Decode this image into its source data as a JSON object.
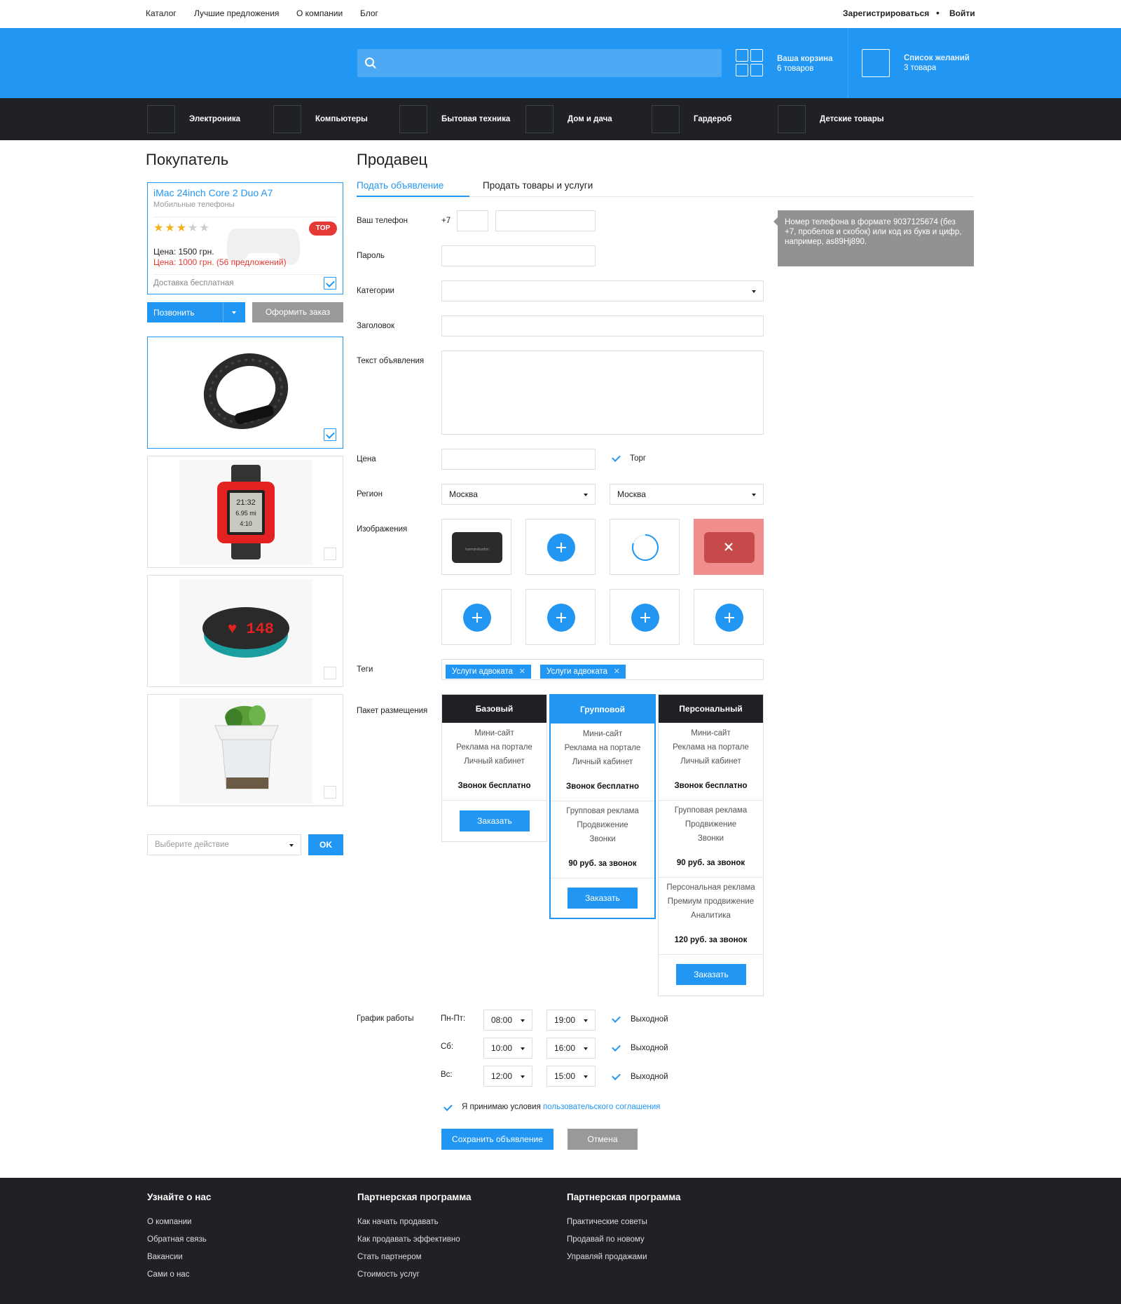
{
  "topnav": {
    "links": [
      "Каталог",
      "Лучшие предложения",
      "О компании",
      "Блог"
    ],
    "register": "Зарегистрироваться",
    "login": "Войти"
  },
  "header": {
    "search_placeholder": "",
    "cart": {
      "title": "Ваша корзина",
      "count": "6 товаров"
    },
    "wishlist": {
      "title": "Список желаний",
      "count": "3 товара"
    }
  },
  "categories": [
    "Электроника",
    "Компьютеры",
    "Бытовая техника",
    "Дом и дача",
    "Гардероб",
    "Детские товары"
  ],
  "buyer": {
    "title": "Покупатель",
    "product": {
      "name": "iMac 24inch Core 2 Duo A7",
      "category": "Мобильные телефоны",
      "rating": 3,
      "badge": "TOP",
      "price_old": "Цена: 1500 грн.",
      "price_new": "Цена: 1000 грн. (56 предложений)",
      "delivery": "Доставка бесплатная"
    },
    "call_button": "Позвонить",
    "order_button": "Оформить заказ",
    "action_placeholder": "Выберите действие",
    "ok_button": "OK"
  },
  "seller": {
    "title": "Продавец",
    "tabs": [
      "Подать объявление",
      "Продать товары и услуги"
    ],
    "labels": {
      "phone": "Ваш телефон",
      "phone_prefix": "+7",
      "password": "Пароль",
      "category": "Категории",
      "headline": "Заголовок",
      "text": "Текст объявления",
      "price": "Цена",
      "bargain": "Торг",
      "region": "Регион",
      "images": "Изображения",
      "tags": "Теги",
      "package": "Пакет размещения",
      "schedule": "График работы"
    },
    "regions": [
      "Москва",
      "Москва"
    ],
    "tooltip": "Номер телефона в формате 9037125674 (без +7, пробелов и скобок) или код из букв и цифр, например, as89Hj890.",
    "tags": [
      "Услуги адвоката",
      "Услуги адвоката"
    ],
    "packages": [
      {
        "name": "Базовый",
        "features": [
          "Мини-сайт",
          "Реклама на портале",
          "Личный кабинет"
        ],
        "price": "Звонок бесплатно",
        "order": "Заказать"
      },
      {
        "name": "Групповой",
        "features": [
          "Мини-сайт",
          "Реклама на портале",
          "Личный кабинет"
        ],
        "price": "Звонок бесплатно",
        "features2": [
          "Групповая реклама",
          "Продвижение",
          "Звонки"
        ],
        "price2": "90 руб. за звонок",
        "order": "Заказать"
      },
      {
        "name": "Персональный",
        "features": [
          "Мини-сайт",
          "Реклама на портале",
          "Личный кабинет"
        ],
        "price": "Звонок бесплатно",
        "features2": [
          "Групповая реклама",
          "Продвижение",
          "Звонки"
        ],
        "price2": "90 руб. за звонок",
        "features3": [
          "Персональная реклама",
          "Премиум продвижение",
          "Аналитика"
        ],
        "price3": "120 руб. за звонок",
        "order": "Заказать"
      }
    ],
    "schedule": [
      {
        "day": "Пн-Пт:",
        "from": "08:00",
        "to": "19:00",
        "dayoff": "Выходной"
      },
      {
        "day": "Сб:",
        "from": "10:00",
        "to": "16:00",
        "dayoff": "Выходной"
      },
      {
        "day": "Вс:",
        "from": "12:00",
        "to": "15:00",
        "dayoff": "Выходной"
      }
    ],
    "agree_text": "Я принимаю условия",
    "agree_link": "пользовательского соглашения",
    "save_button": "Сохранить объявление",
    "cancel_button": "Отмена"
  },
  "footer": {
    "columns": [
      {
        "title": "Узнайте о нас",
        "links": [
          "О компании",
          "Обратная связь",
          "Вакансии",
          "Сами о нас"
        ]
      },
      {
        "title": "Партнерская программа",
        "links": [
          "Как начать продавать",
          "Как продавать эффективно",
          "Стать партнером",
          "Стоимость услуг"
        ]
      },
      {
        "title": "Партнерская программа",
        "links": [
          "Практические советы",
          "Продавай по новому",
          "Управляй продажами"
        ]
      }
    ]
  },
  "colors": {
    "accent": "#2196f3",
    "dark": "#1f2125",
    "danger": "#e53935"
  }
}
